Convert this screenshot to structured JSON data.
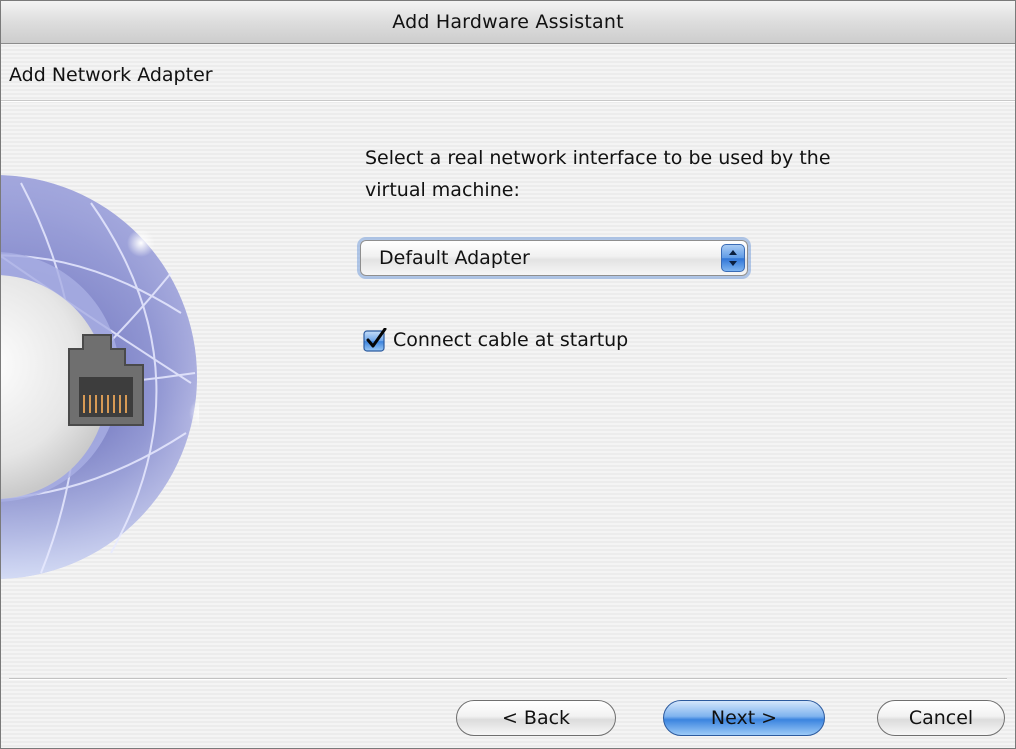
{
  "window": {
    "title": "Add Hardware Assistant"
  },
  "header": {
    "title": "Add Network Adapter"
  },
  "main": {
    "instruction_line1": "Select a real network interface to be used by the",
    "instruction_line2": "virtual machine:",
    "adapter_select": {
      "selected": "Default Adapter"
    },
    "connect_checkbox": {
      "label": "Connect cable at startup",
      "checked": true
    }
  },
  "buttons": {
    "back": "< Back",
    "next": "Next >",
    "cancel": "Cancel"
  },
  "icons": {
    "illustration": "network-globe-icon",
    "port": "ethernet-port-icon",
    "popup": "chevron-updown-icon",
    "check": "checkmark-icon"
  },
  "colors": {
    "accent": "#3b84df",
    "globe": "#8d93cf"
  }
}
